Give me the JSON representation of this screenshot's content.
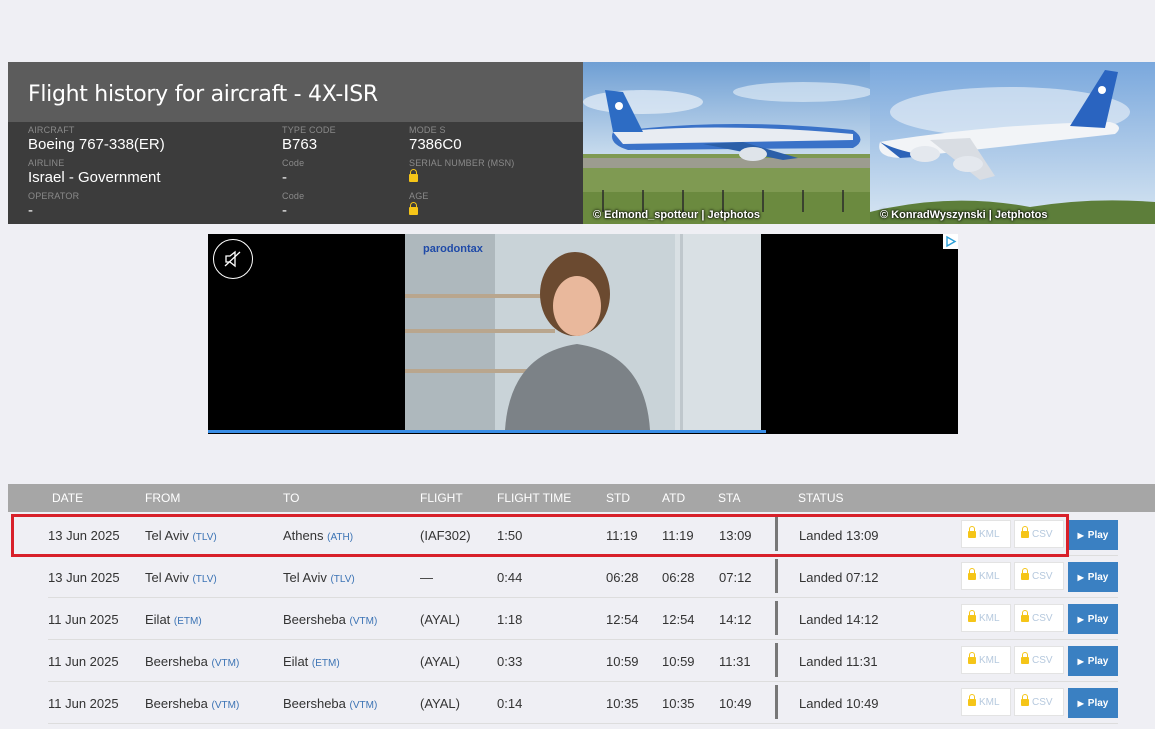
{
  "header": {
    "title": "Flight history for aircraft - 4X-ISR",
    "fields": [
      {
        "label": "AIRCRAFT",
        "value": "Boeing 767-338(ER)"
      },
      {
        "label": "TYPE CODE",
        "value": "B763"
      },
      {
        "label": "MODE S",
        "value": "7386C0"
      },
      {
        "label": "AIRLINE",
        "value": "Israel - Government"
      },
      {
        "label": "Code",
        "value": "-"
      },
      {
        "label": "SERIAL NUMBER (MSN)",
        "value": ""
      },
      {
        "label": "OPERATOR",
        "value": "-"
      },
      {
        "label": "Code",
        "value": "-"
      },
      {
        "label": "AGE",
        "value": ""
      }
    ]
  },
  "photos": [
    {
      "credit": "© Edmond_spotteur | Jetphotos"
    },
    {
      "credit": "© KonradWyszynski | Jetphotos"
    }
  ],
  "ad": {
    "brand": "parodontax"
  },
  "table": {
    "columns": [
      "DATE",
      "FROM",
      "TO",
      "FLIGHT",
      "FLIGHT TIME",
      "STD",
      "ATD",
      "STA",
      "STATUS"
    ],
    "kml_label": "KML",
    "csv_label": "CSV",
    "play_label": "Play",
    "rows": [
      {
        "date": "13 Jun 2025",
        "from": "Tel Aviv",
        "from_code": "(TLV)",
        "to": "Athens",
        "to_code": "(ATH)",
        "flight": "(IAF302)",
        "time": "1:50",
        "std": "11:19",
        "atd": "11:19",
        "sta": "13:09",
        "status": "Landed 13:09"
      },
      {
        "date": "13 Jun 2025",
        "from": "Tel Aviv",
        "from_code": "(TLV)",
        "to": "Tel Aviv",
        "to_code": "(TLV)",
        "flight": "—",
        "time": "0:44",
        "std": "06:28",
        "atd": "06:28",
        "sta": "07:12",
        "status": "Landed 07:12"
      },
      {
        "date": "11 Jun 2025",
        "from": "Eilat",
        "from_code": "(ETM)",
        "to": "Beersheba",
        "to_code": "(VTM)",
        "flight": "(AYAL)",
        "time": "1:18",
        "std": "12:54",
        "atd": "12:54",
        "sta": "14:12",
        "status": "Landed 14:12"
      },
      {
        "date": "11 Jun 2025",
        "from": "Beersheba",
        "from_code": "(VTM)",
        "to": "Eilat",
        "to_code": "(ETM)",
        "flight": "(AYAL)",
        "time": "0:33",
        "std": "10:59",
        "atd": "10:59",
        "sta": "11:31",
        "status": "Landed 11:31"
      },
      {
        "date": "11 Jun 2025",
        "from": "Beersheba",
        "from_code": "(VTM)",
        "to": "Beersheba",
        "to_code": "(VTM)",
        "flight": "(AYAL)",
        "time": "0:14",
        "std": "10:35",
        "atd": "10:35",
        "sta": "10:49",
        "status": "Landed 10:49"
      }
    ]
  },
  "colors": {
    "highlight": "#d8202a",
    "play": "#3a80c2",
    "lock": "#f5c518"
  }
}
